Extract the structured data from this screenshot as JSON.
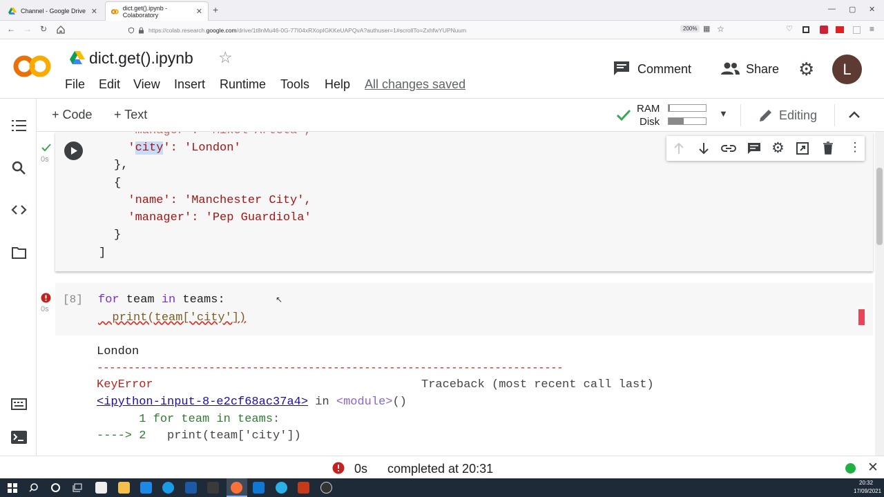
{
  "browser": {
    "tabs": [
      {
        "title": "Channel - Google Drive",
        "active": false
      },
      {
        "title": "dict.get().ipynb - Colaboratory",
        "active": true
      }
    ],
    "new_tab": "+",
    "url_prefix": "https://colab.research.",
    "url_domain": "google.com",
    "url_suffix": "/drive/1t8nMu46-0G-77I04xRXopIGKKeUAPQvA?authuser=1#scrollTo=ZxhfwYUPNuum",
    "zoom": "200%",
    "window_controls": [
      "—",
      "▢",
      "✕"
    ]
  },
  "colab": {
    "logo_text": "CO",
    "notebook_title": "dict.get().ipynb",
    "menu": [
      "File",
      "Edit",
      "View",
      "Insert",
      "Runtime",
      "Tools",
      "Help"
    ],
    "save_status": "All changes saved",
    "comment_label": "Comment",
    "share_label": "Share",
    "avatar_letter": "L"
  },
  "toolbar": {
    "add_code": "+ Code",
    "add_text": "+ Text",
    "ram_label": "RAM",
    "disk_label": "Disk",
    "ram_fraction": 0.04,
    "disk_fraction": 0.4,
    "editing_label": "Editing"
  },
  "cell1": {
    "exec_time": "0s",
    "lines": {
      "l0": "  'manager': 'Mikel Arteta',",
      "l1_pre": "  '",
      "l1_key": "city",
      "l1_post": "': 'London'",
      "l2": "},",
      "l3": "{",
      "l4": "  'name': 'Manchester City',",
      "l5": "  'manager': 'Pep Guardiola'",
      "l6": "}",
      "l7": "]"
    }
  },
  "cell2": {
    "prompt": "[8]",
    "exec_time": "0s",
    "line1_kw1": "for",
    "line1_mid": " team ",
    "line1_kw2": "in",
    "line1_end": " teams:",
    "line2": "  print(team['city'])"
  },
  "output": {
    "line1": "London",
    "separator": "---------------------------------------------------------------------------",
    "error_name": "KeyError",
    "traceback_label": "Traceback (most recent call last)",
    "input_ref": "<ipython-input-8-e2cf68ac37a4>",
    "in_word": " in ",
    "module_ref": "<module>",
    "module_parens": "()",
    "tb_line1": "      1 for team in teams:",
    "tb_arrow": "----> 2",
    "tb_line2": "   print(team['city'])"
  },
  "status": {
    "time": "0s",
    "completed": "completed at 20:31"
  },
  "taskbar": {
    "clock_time": "20:32",
    "clock_date": "17/09/2021"
  }
}
